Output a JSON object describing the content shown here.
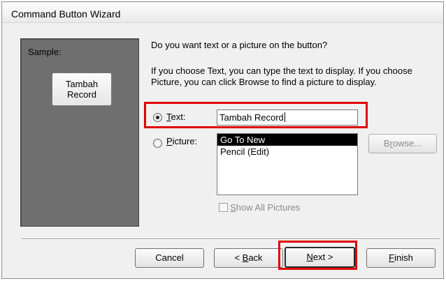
{
  "window": {
    "title": "Command Button Wizard"
  },
  "sample": {
    "label": "Sample:",
    "button_line1": "Tambah",
    "button_line2": "Record"
  },
  "prompt": {
    "question": "Do you want text or a picture on the button?",
    "explanation": "If you choose Text, you can type the text to display.  If you choose Picture, you can click Browse to find a picture to display."
  },
  "options": {
    "text_label_accel": "T",
    "text_label_rest": "ext:",
    "text_selected": true,
    "text_value": "Tambah Record",
    "picture_label_accel": "P",
    "picture_label_rest": "icture:",
    "picture_selected": false
  },
  "picture_list": {
    "items": [
      "Go To New",
      "Pencil (Edit)"
    ],
    "selected_index": 0
  },
  "browse_button": {
    "label_pre": "B",
    "label_accel": "r",
    "label_post": "owse..."
  },
  "show_all_pictures": {
    "label_accel": "S",
    "label_rest": "how All Pictures",
    "checked": false
  },
  "footer": {
    "cancel_label": "Cancel",
    "back_pre": "< ",
    "back_accel": "B",
    "back_post": "ack",
    "next_accel": "N",
    "next_post": "ext >",
    "finish_accel": "F",
    "finish_post": "inish"
  },
  "colors": {
    "highlight": "#e00000",
    "sample_panel": "#6f6f6f",
    "selected_item_bg": "#000000"
  }
}
